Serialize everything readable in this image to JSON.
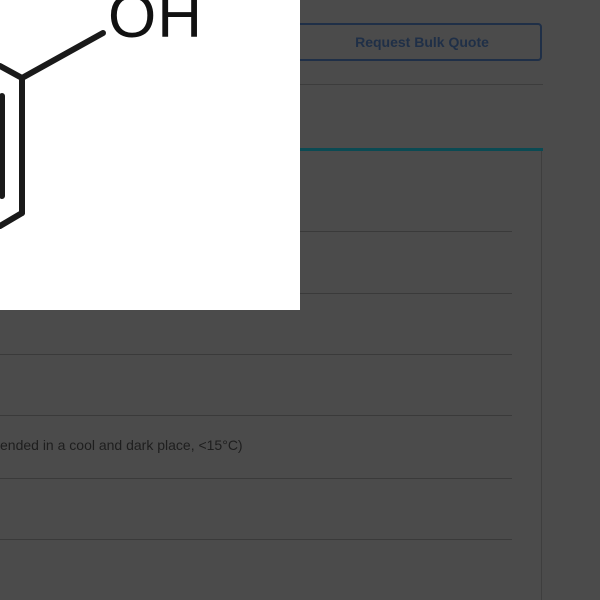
{
  "actions": {
    "bulk_quote_label": "Request Bulk Quote"
  },
  "specs": {
    "storage_text": "ended in a cool and dark place, <15°C)"
  },
  "structure_image": {
    "group_label": "OH"
  },
  "colors": {
    "overlay_dim": "#4b4b4b",
    "button_border": "#1f2f47",
    "tab_accent": "#0b4a53",
    "image_bg": "#ffffff"
  }
}
